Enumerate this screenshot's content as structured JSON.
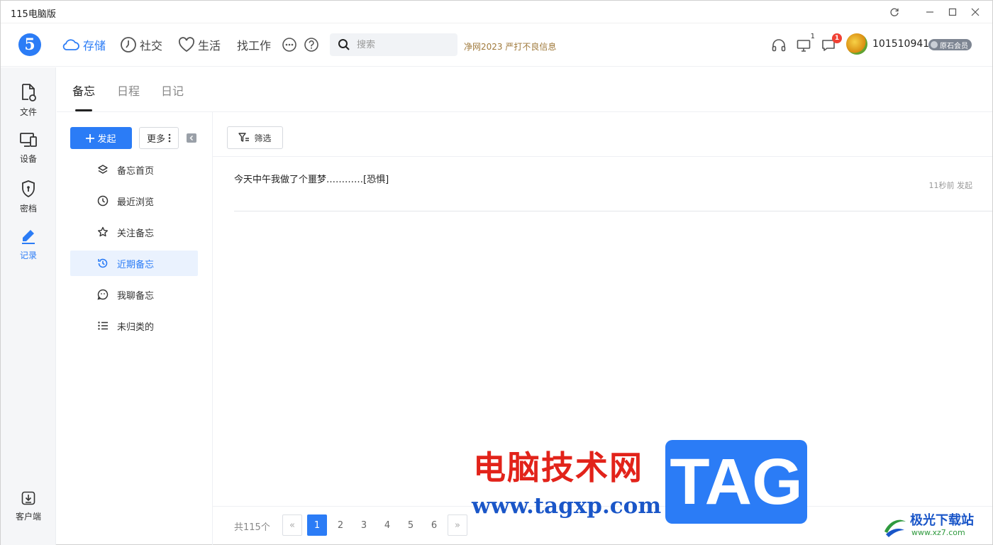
{
  "window": {
    "title": "115电脑版",
    "controls": {
      "refresh": "refresh-icon",
      "minimize": "minimize-icon",
      "maximize": "maximize-icon",
      "close": "close-icon"
    }
  },
  "topnav": {
    "logo": "5",
    "items": [
      {
        "label": "存储",
        "icon": "cloud-icon",
        "active": true
      },
      {
        "label": "社交",
        "icon": "clock-icon",
        "active": false
      },
      {
        "label": "生活",
        "icon": "heart-icon",
        "active": false
      },
      {
        "label": "找工作",
        "active": false
      }
    ],
    "search": {
      "placeholder": "搜索"
    },
    "notice": "净网2023 严打不良信息",
    "device_count": "1",
    "message_badge": "1",
    "user": {
      "name": "101510941",
      "vip_label": "原石会员"
    }
  },
  "rail": {
    "items": [
      {
        "label": "文件",
        "icon": "file-icon"
      },
      {
        "label": "设备",
        "icon": "device-icon"
      },
      {
        "label": "密档",
        "icon": "shield-icon"
      },
      {
        "label": "记录",
        "icon": "pen-icon",
        "active": true
      }
    ],
    "bottom": {
      "label": "客户端",
      "icon": "download-box-icon"
    }
  },
  "tabs": [
    {
      "label": "备忘",
      "active": true
    },
    {
      "label": "日程",
      "active": false
    },
    {
      "label": "日记",
      "active": false
    }
  ],
  "sidebar": {
    "create_label": "发起",
    "more_label": "更多",
    "menu": [
      {
        "label": "备忘首页",
        "icon": "layers-icon"
      },
      {
        "label": "最近浏览",
        "icon": "history-icon"
      },
      {
        "label": "关注备忘",
        "icon": "star-icon"
      },
      {
        "label": "近期备忘",
        "icon": "recent-icon",
        "active": true
      },
      {
        "label": "我聊备忘",
        "icon": "chat-icon"
      },
      {
        "label": "未归类的",
        "icon": "list-icon"
      }
    ]
  },
  "main": {
    "filter_label": "筛选",
    "memos": [
      {
        "text": "今天中午我做了个噩梦…………[恐惧]",
        "meta": "11秒前 发起"
      }
    ]
  },
  "pagination": {
    "total": "共115个",
    "prev": "«",
    "next": "»",
    "pages": [
      "1",
      "2",
      "3",
      "4",
      "5",
      "6"
    ],
    "current": "1"
  },
  "watermark": {
    "site_title": "电脑技术网",
    "site_url": "www.tagxp.com",
    "tag": "TAG",
    "xz_name": "极光下载站",
    "xz_url": "www.xz7.com"
  },
  "colors": {
    "accent": "#2b7cf6",
    "badge": "#f04134",
    "notice": "#a07a3c"
  }
}
